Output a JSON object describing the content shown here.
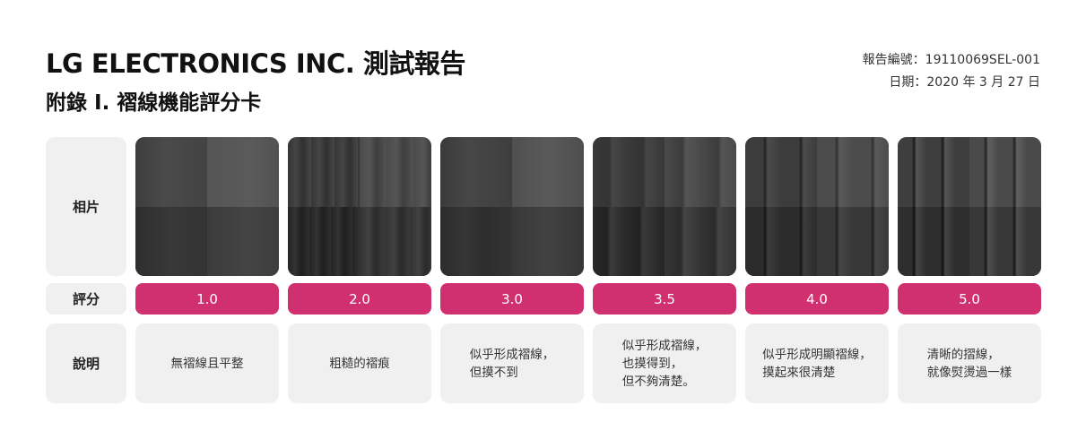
{
  "header": {
    "title": "LG ELECTRONICS INC. 測試報告",
    "subtitle": "附錄 I. 褶線機能評分卡",
    "report_no": "報告編號：19110069SEL-001",
    "date": "日期：2020 年 3 月 27 日"
  },
  "rows": {
    "photo_label": "相片",
    "score_label": "評分",
    "desc_label": "說明"
  },
  "cards": [
    {
      "score": "1.0",
      "description": "無褶線且平整"
    },
    {
      "score": "2.0",
      "description": "粗糙的褶痕"
    },
    {
      "score": "3.0",
      "description": "似乎形成褶線，\n但摸不到"
    },
    {
      "score": "3.5",
      "description": "似乎形成褶線，\n也摸得到，\n但不夠清楚。"
    },
    {
      "score": "4.0",
      "description": "似乎形成明顯褶線，\n摸起來很清楚"
    },
    {
      "score": "5.0",
      "description": "清晰的摺線，\n就像熨燙過一樣"
    }
  ],
  "colors": {
    "score_accent": "#d0306f",
    "panel_bg": "#f0f0f0",
    "fabric_dark": "#3a3a3a"
  }
}
